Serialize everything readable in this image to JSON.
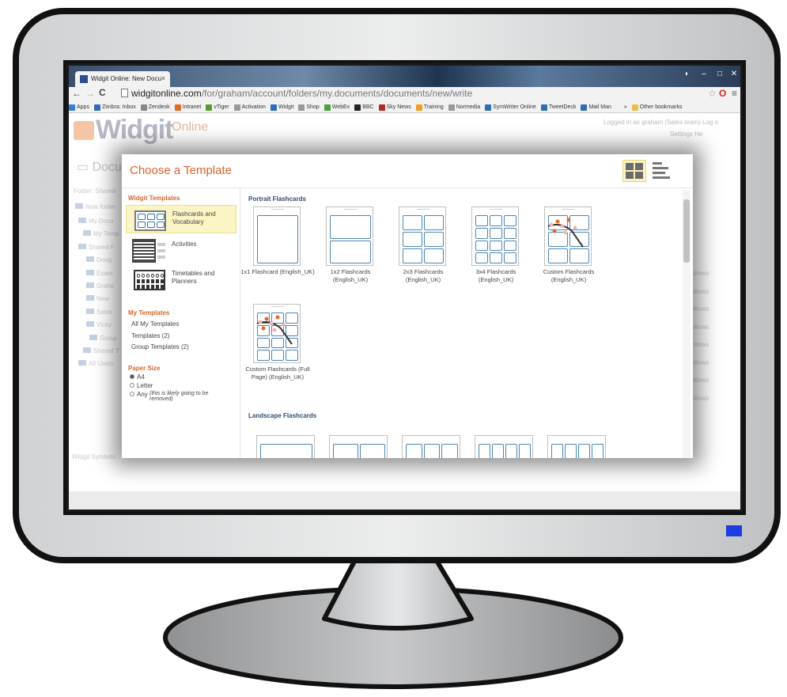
{
  "browser": {
    "tab_title": "Widgit Online: New Docu",
    "tab_close": "×",
    "url_host": "widgitonline.com",
    "url_path": "/for/graham/account/folders/my.documents/documents/new/write",
    "star_icon": "star-icon",
    "bookmarks": [
      {
        "label": "Apps",
        "color": "#3b7ddd"
      },
      {
        "label": "Zimbra: Inbox",
        "color": "#2f6db5"
      },
      {
        "label": "Zendesk",
        "color": "#888888"
      },
      {
        "label": "Intranet",
        "color": "#e2692d"
      },
      {
        "label": "vTiger",
        "color": "#5a9a2c"
      },
      {
        "label": "Activation",
        "color": "#999999"
      },
      {
        "label": "Widgit",
        "color": "#2f6db5"
      },
      {
        "label": "Shop",
        "color": "#999999"
      },
      {
        "label": "WebEx",
        "color": "#4aa03b"
      },
      {
        "label": "BBC",
        "color": "#222222"
      },
      {
        "label": "Sky News",
        "color": "#b32a2a"
      },
      {
        "label": "Training",
        "color": "#f0a020"
      },
      {
        "label": "Normedia",
        "color": "#999999"
      },
      {
        "label": "SymWriter Online",
        "color": "#2f6db5"
      },
      {
        "label": "TweetDeck",
        "color": "#2f6db5"
      },
      {
        "label": "Mail Man",
        "color": "#2f6db5"
      },
      {
        "label": "»",
        "color": "#f2f2f2"
      },
      {
        "label": "Other bookmarks",
        "color": "#e8c04a"
      }
    ]
  },
  "page": {
    "logo": "Widgit",
    "logo_sub": "Online",
    "logged_in": "Logged in as graham (Sales team)   Log o",
    "settings": "Settings   He",
    "docs_heading": "Docu",
    "folder": "Folder: Shared",
    "new_button": "New folder",
    "tree": [
      "My Docu",
      "My Temp",
      "Shared F",
      "Doug",
      "Exam",
      "Graha",
      "New",
      "Sales",
      "Vicky",
      "Group",
      "Shared T",
      "All Users"
    ],
    "follows": [
      "ollows",
      "ollows",
      "ollows",
      "ollows",
      "ollows",
      "ollows",
      "ollows",
      "ollows"
    ],
    "footer": "Widgit Symbols"
  },
  "modal": {
    "title": "Choose a Template",
    "widgit_templates_heading": "Widgit Templates",
    "categories": [
      {
        "label": "Flashcards and Vocabulary",
        "selected": true
      },
      {
        "label": "Activities",
        "selected": false
      },
      {
        "label": "Timetables and Planners",
        "selected": false
      }
    ],
    "my_templates_heading": "My Templates",
    "my_templates": [
      "All My Templates",
      "Templates (2)",
      "Group Templates (2)"
    ],
    "paper_size_heading": "Paper Size",
    "paper_sizes": [
      {
        "label": "A4",
        "checked": true
      },
      {
        "label": "Letter",
        "checked": false
      },
      {
        "label": "Any",
        "note": "(this is likely going to be removed)",
        "checked": false
      }
    ],
    "portrait_heading": "Portrait Flashcards",
    "portrait_cards": [
      {
        "label": "1x1 Flashcard (English_UK)",
        "grid": [
          1,
          1
        ]
      },
      {
        "label": "1x2 Flashcards (English_UK)",
        "grid": [
          1,
          2
        ]
      },
      {
        "label": "2x3 Flashcards (English_UK)",
        "grid": [
          2,
          3
        ]
      },
      {
        "label": "3x4 Flashcards (English_UK)",
        "grid": [
          3,
          4
        ]
      },
      {
        "label": "Custom Flashcards (English_UK)",
        "grid": [
          2,
          3
        ],
        "custom": true
      },
      {
        "label": "Custom Flashcards (Full Page) (English_UK)",
        "grid": [
          3,
          4
        ],
        "custom": true
      }
    ],
    "landscape_heading": "Landscape Flashcards",
    "landscape_cards": [
      {
        "grid": [
          1,
          1
        ]
      },
      {
        "grid": [
          2,
          1
        ]
      },
      {
        "grid": [
          3,
          1
        ]
      },
      {
        "grid": [
          4,
          1
        ]
      },
      {
        "grid": [
          4,
          2
        ]
      }
    ]
  },
  "colors": {
    "accent_orange": "#d8642a",
    "heading_blue": "#314a74",
    "card_blue": "#4a86b5",
    "power_led": "#1b3ee0"
  }
}
